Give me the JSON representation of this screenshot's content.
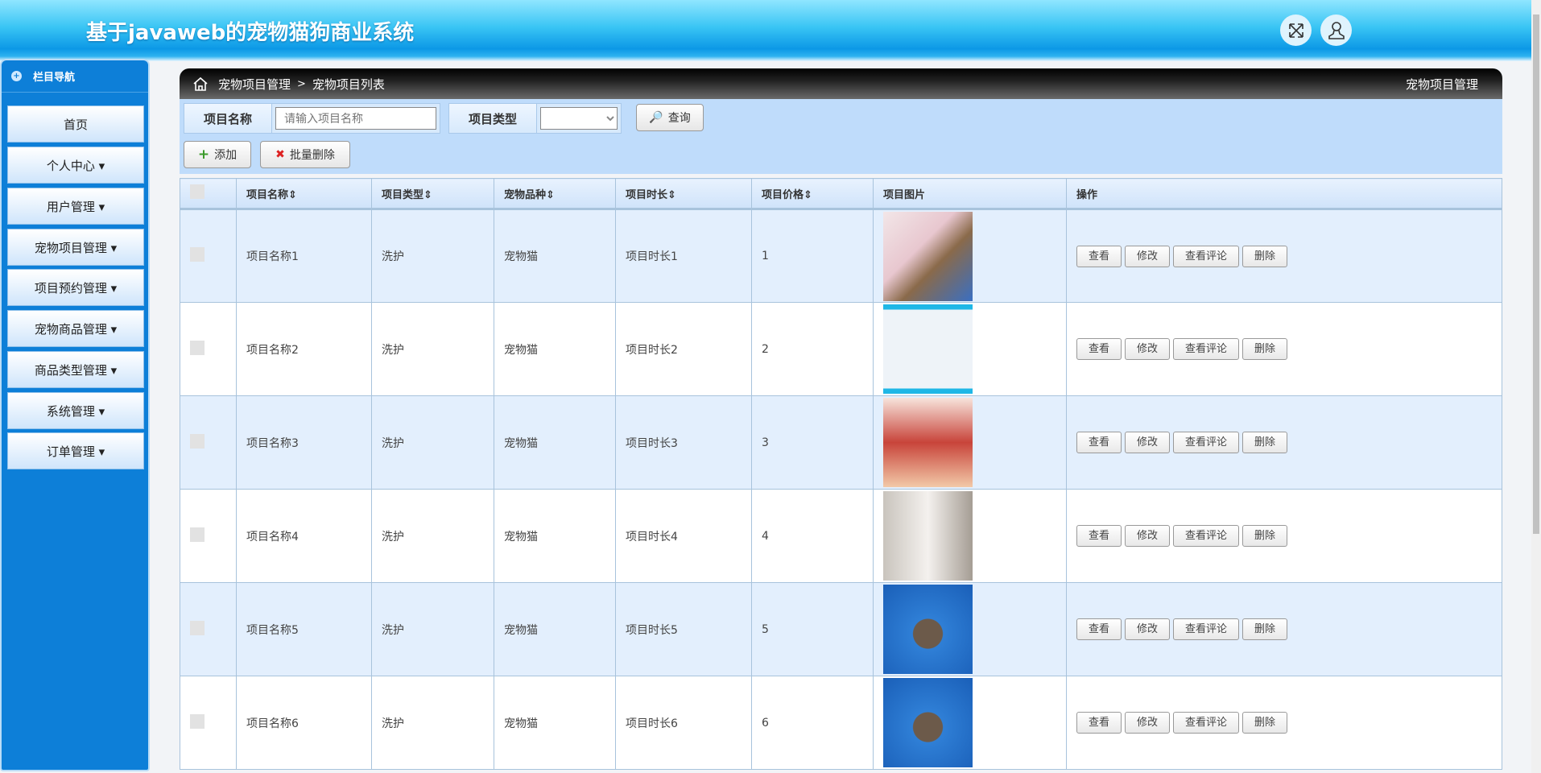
{
  "header": {
    "title": "基于javaweb的宠物猫狗商业系统",
    "icons": [
      "fullscreen-icon",
      "user-icon"
    ]
  },
  "sidebar": {
    "title": "栏目导航",
    "items": [
      "首页",
      "个人中心 ▾",
      "用户管理 ▾",
      "宠物项目管理 ▾",
      "项目预约管理 ▾",
      "宠物商品管理 ▾",
      "商品类型管理 ▾",
      "系统管理 ▾",
      "订单管理 ▾"
    ]
  },
  "breadcrumb": {
    "section": "宠物项目管理",
    "sep": ">",
    "page": "宠物项目列表",
    "right": "宠物项目管理"
  },
  "filter": {
    "name_label": "项目名称",
    "name_placeholder": "请输入项目名称",
    "type_label": "项目类型",
    "type_value": "",
    "search": "查询",
    "add": "添加",
    "batch_delete": "批量删除"
  },
  "table": {
    "headers": [
      "项目名称⇕",
      "项目类型⇕",
      "宠物品种⇕",
      "项目时长⇕",
      "项目价格⇕",
      "项目图片",
      "操作"
    ],
    "actions": [
      "查看",
      "修改",
      "查看评论",
      "删除"
    ],
    "rows": [
      {
        "name": "项目名称1",
        "type": "洗护",
        "breed": "宠物猫",
        "duration": "项目时长1",
        "price": "1"
      },
      {
        "name": "项目名称2",
        "type": "洗护",
        "breed": "宠物猫",
        "duration": "项目时长2",
        "price": "2"
      },
      {
        "name": "项目名称3",
        "type": "洗护",
        "breed": "宠物猫",
        "duration": "项目时长3",
        "price": "3"
      },
      {
        "name": "项目名称4",
        "type": "洗护",
        "breed": "宠物猫",
        "duration": "项目时长4",
        "price": "4"
      },
      {
        "name": "项目名称5",
        "type": "洗护",
        "breed": "宠物猫",
        "duration": "项目时长5",
        "price": "5"
      },
      {
        "name": "项目名称6",
        "type": "洗护",
        "breed": "宠物猫",
        "duration": "项目时长6",
        "price": "6"
      }
    ]
  }
}
